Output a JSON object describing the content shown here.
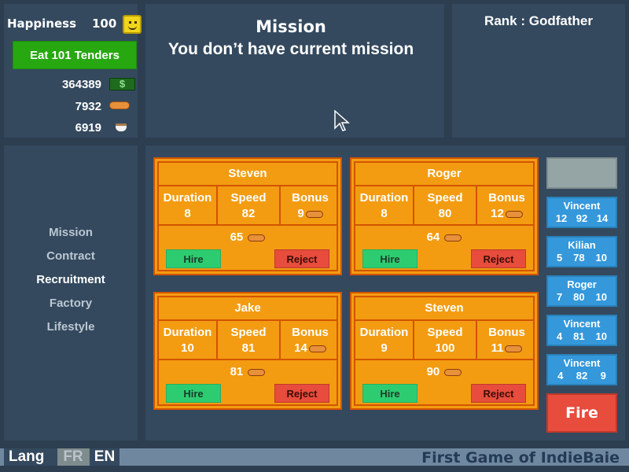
{
  "stats": {
    "happiness_label": "Happiness",
    "happiness_value": "100",
    "goal_button": "Eat 101 Tenders",
    "money": "364389",
    "money_icon": "dollar-bill-icon",
    "tenders": "7932",
    "tender_icon": "tender-icon",
    "cups": "6919",
    "cup_icon": "cup-icon"
  },
  "mission": {
    "title": "Mission",
    "text": "You don’t have current mission"
  },
  "rank": {
    "text": "Rank : Godfather"
  },
  "menu": {
    "items": [
      {
        "label": "Mission",
        "active": false
      },
      {
        "label": "Contract",
        "active": false
      },
      {
        "label": "Recruitment",
        "active": true
      },
      {
        "label": "Factory",
        "active": false
      },
      {
        "label": "Lifestyle",
        "active": false
      }
    ]
  },
  "candidates": [
    {
      "name": "Steven",
      "duration": "8",
      "speed": "82",
      "bonus": "9",
      "cost": "65"
    },
    {
      "name": "Roger",
      "duration": "8",
      "speed": "80",
      "bonus": "12",
      "cost": "64"
    },
    {
      "name": "Jake",
      "duration": "10",
      "speed": "81",
      "bonus": "14",
      "cost": "81"
    },
    {
      "name": "Steven",
      "duration": "9",
      "speed": "100",
      "bonus": "11",
      "cost": "90"
    }
  ],
  "card_labels": {
    "duration": "Duration",
    "speed": "Speed",
    "bonus": "Bonus",
    "hire": "Hire",
    "reject": "Reject"
  },
  "employees": [
    {
      "name": "Vincent",
      "a": "12",
      "b": "92",
      "c": "14"
    },
    {
      "name": "Kilian",
      "a": "5",
      "b": "78",
      "c": "10"
    },
    {
      "name": "Roger",
      "a": "7",
      "b": "80",
      "c": "10"
    },
    {
      "name": "Vincent",
      "a": "4",
      "b": "81",
      "c": "10"
    },
    {
      "name": "Vincent",
      "a": "4",
      "b": "82",
      "c": "9"
    }
  ],
  "fire_button": "Fire",
  "footer": {
    "lang_label": "Lang",
    "fr": "FR",
    "en": "EN",
    "credit": "First Game of IndieBaie"
  },
  "colors": {
    "background": "#2c3e50",
    "panel": "#34495e",
    "card": "#f39c12",
    "card_border": "#d35400",
    "hire": "#2ecc71",
    "reject": "#e74c3c",
    "employee": "#3498db",
    "goal": "#27a811"
  }
}
